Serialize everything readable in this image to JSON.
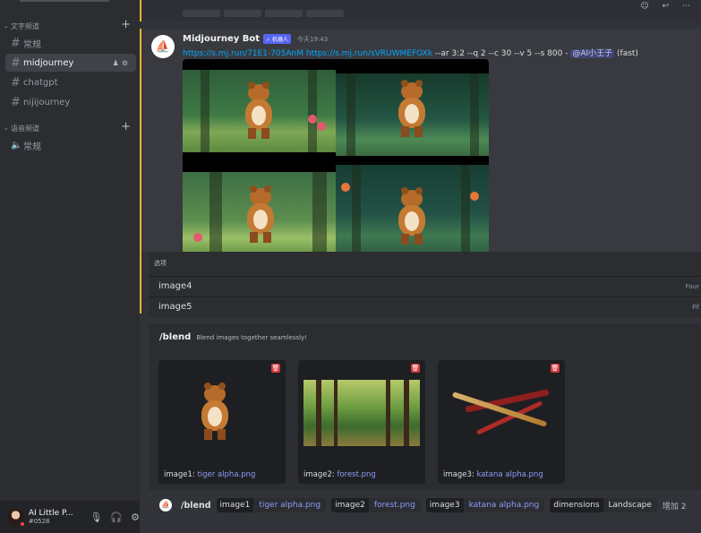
{
  "sidebar": {
    "categories": [
      {
        "label": "文字频道"
      },
      {
        "label": "语音频道"
      }
    ],
    "text_channels": [
      {
        "label": "常规"
      },
      {
        "label": "midjourney"
      },
      {
        "label": "chatgpt"
      },
      {
        "label": "nijijourney"
      }
    ],
    "voice_channels": [
      {
        "label": "常规"
      }
    ],
    "user": {
      "name": "AI Little P...",
      "tag": "#0528"
    }
  },
  "message": {
    "author": "Midjourney Bot",
    "badge": "✓ 机器人",
    "time": "今天19:43",
    "link1": "https://s.mj.run/71E1-705AnM",
    "link2": "https://s.mj.run/sVRUWMEFOXk",
    "params": " --ar 3:2 --q 2 --c 30 --v 5 --s 800 - ",
    "mention": "@AI小王子",
    "speed": " (fast)"
  },
  "options": {
    "title": "选项",
    "items": [
      {
        "label": "image4",
        "desc": "Four"
      },
      {
        "label": "image5",
        "desc": "Fif"
      }
    ]
  },
  "blend": {
    "command": "/blend",
    "description": "Blend images together seamlessly!",
    "cards": [
      {
        "label": "image1: ",
        "file": "tiger alpha.png"
      },
      {
        "label": "image2: ",
        "file": "forest.png"
      },
      {
        "label": "image3: ",
        "file": "katana alpha.png"
      }
    ]
  },
  "input": {
    "command": "/blend",
    "params": [
      {
        "key": "image1",
        "value": "tiger alpha.png"
      },
      {
        "key": "image2",
        "value": "forest.png"
      },
      {
        "key": "image3",
        "value": "katana alpha.png"
      },
      {
        "key": "dimensions",
        "value": "Landscape"
      }
    ],
    "more": "增加 2"
  },
  "colors": {
    "accent": "#f0b232",
    "link": "#00a8fc",
    "brand": "#5865f2",
    "delete": "#da373c"
  }
}
